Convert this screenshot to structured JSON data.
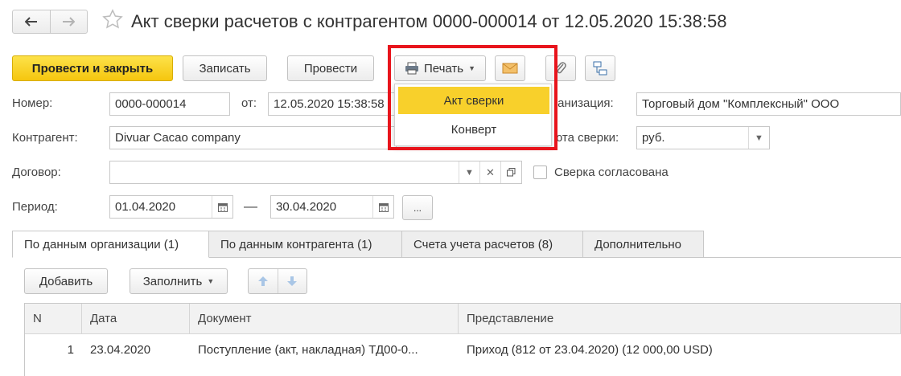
{
  "header": {
    "title": "Акт сверки расчетов с контрагентом 0000-000014 от 12.05.2020 15:38:58"
  },
  "toolbar": {
    "post_close_label": "Провести и закрыть",
    "save_label": "Записать",
    "post_label": "Провести",
    "print_label": "Печать"
  },
  "print_menu": {
    "items": [
      "Акт сверки",
      "Конверт"
    ],
    "selected": "Акт сверки"
  },
  "form": {
    "number_label": "Номер:",
    "number_value": "0000-000014",
    "date_label": "от:",
    "date_value": "12.05.2020 15:38:58",
    "org_label": "Организация:",
    "org_label_visible": "ганизация:",
    "org_value": "Торговый дом \"Комплексный\" ООО",
    "counterparty_label": "Контрагент:",
    "counterparty_value": "Divuar Cacao company",
    "currency_label_visible": "юта сверки:",
    "currency_value": "руб.",
    "contract_label": "Договор:",
    "contract_value": "",
    "agreed_label": "Сверка согласована",
    "agreed_checked": false,
    "period_label": "Период:",
    "period_from": "01.04.2020",
    "period_sep": "—",
    "period_to": "30.04.2020",
    "period_more": "..."
  },
  "tabs": [
    {
      "label": "По данным организации (1)",
      "active": true
    },
    {
      "label": "По данным контрагента (1)",
      "active": false
    },
    {
      "label": "Счета учета расчетов (8)",
      "active": false
    },
    {
      "label": "Дополнительно",
      "active": false
    }
  ],
  "table_toolbar": {
    "add_label": "Добавить",
    "fill_label": "Заполнить"
  },
  "table": {
    "columns": [
      "N",
      "Дата",
      "Документ",
      "Представление"
    ],
    "rows": [
      [
        "1",
        "23.04.2020",
        "Поступление (акт, накладная) ТД00-0...",
        "Приход (812 от 23.04.2020) (12 000,00 USD)"
      ]
    ]
  },
  "colors": {
    "accent_yellow": "#f5c60e",
    "highlight_red": "#e8141c"
  }
}
